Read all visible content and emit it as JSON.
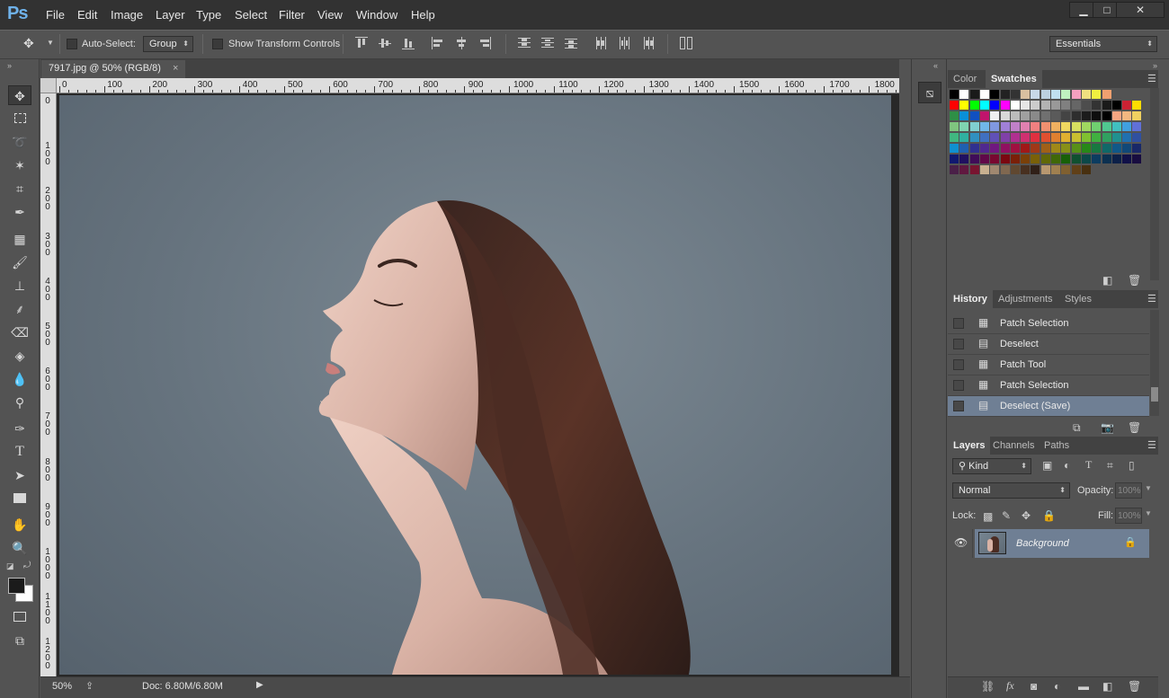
{
  "app": {
    "logo": "Ps"
  },
  "menu": [
    "File",
    "Edit",
    "Image",
    "Layer",
    "Type",
    "Select",
    "Filter",
    "View",
    "Window",
    "Help"
  ],
  "window_controls": {
    "minimize": "▁",
    "maximize": "□",
    "close": "✕"
  },
  "options_bar": {
    "auto_select_label": "Auto-Select:",
    "auto_select_value": "Group",
    "transform_controls_label": "Show Transform Controls",
    "workspace": "Essentials"
  },
  "document": {
    "tab_title": "7917.jpg @ 50% (RGB/8)",
    "tab_close": "×",
    "ruler_h": [
      "0",
      "100",
      "200",
      "300",
      "400",
      "500",
      "600",
      "700",
      "800",
      "900",
      "1000",
      "1100",
      "1200",
      "1300",
      "1400",
      "1500",
      "1600",
      "1700",
      "1800"
    ],
    "ruler_v": [
      "0",
      "100",
      "200",
      "300",
      "400",
      "500",
      "600",
      "700",
      "800",
      "900",
      "1000",
      "1100",
      "1200"
    ]
  },
  "status": {
    "zoom": "50%",
    "doc_size": "Doc: 6.80M/6.80M"
  },
  "color_panel": {
    "tab_color": "Color",
    "tab_swatches": "Swatches"
  },
  "history_panel": {
    "tabs": [
      "History",
      "Adjustments",
      "Styles"
    ],
    "items": [
      {
        "label": "Patch Selection",
        "icon": "patch-icon"
      },
      {
        "label": "Deselect",
        "icon": "doc-icon"
      },
      {
        "label": "Patch Tool",
        "icon": "patch-icon"
      },
      {
        "label": "Patch Selection",
        "icon": "patch-icon"
      },
      {
        "label": "Deselect (Save)",
        "icon": "doc-icon"
      }
    ]
  },
  "layers_panel": {
    "tabs": [
      "Layers",
      "Channels",
      "Paths"
    ],
    "filter": "Kind",
    "blend_mode": "Normal",
    "opacity_label": "Opacity:",
    "opacity_value": "100%",
    "lock_label": "Lock:",
    "fill_label": "Fill:",
    "fill_value": "100%",
    "layer_name": "Background"
  },
  "colors": {
    "accent": "#6fb2ea",
    "selection": "#6f7f94"
  }
}
